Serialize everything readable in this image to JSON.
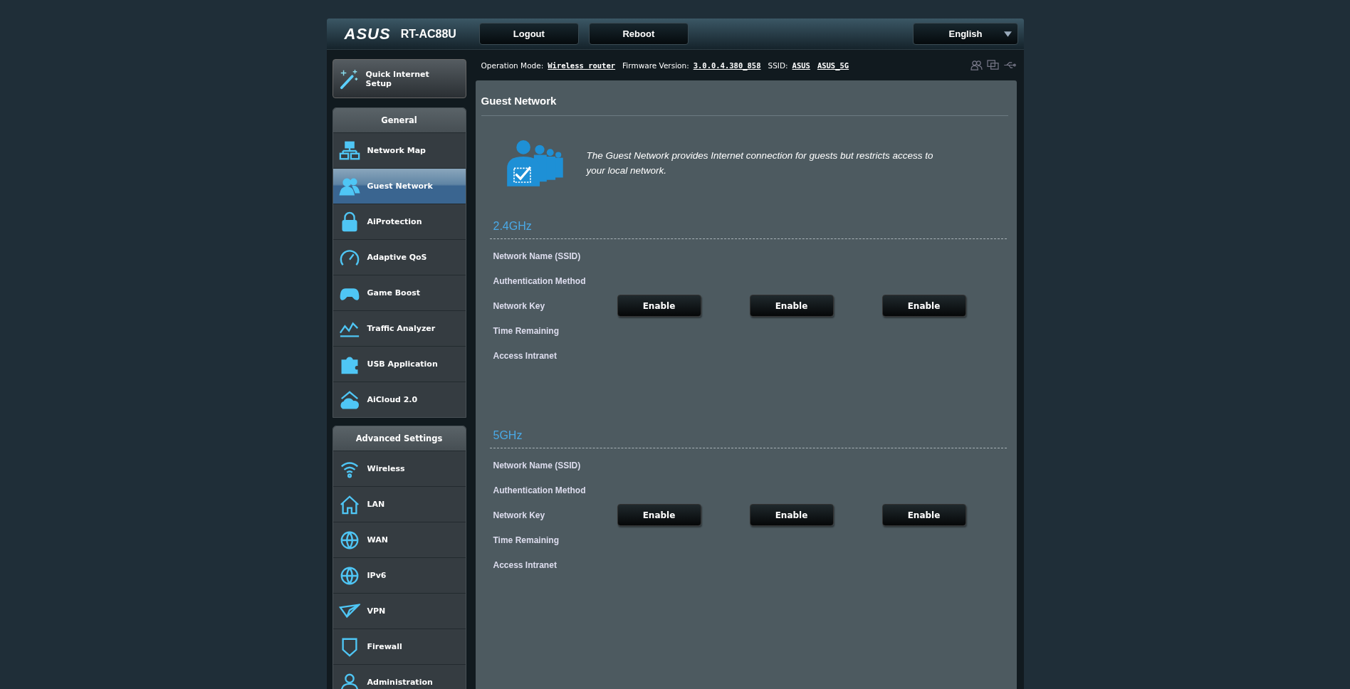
{
  "header": {
    "brand": "ASUS",
    "model": "RT-AC88U",
    "buttons": [
      "Logout",
      "Reboot"
    ],
    "language": "English"
  },
  "status_bar": {
    "items": [
      {
        "label": "Operation Mode:",
        "value": "Wireless router"
      },
      {
        "label": "Firmware Version:",
        "value": "3.0.0.4.380_858"
      },
      {
        "label": "SSID:",
        "value": "ASUS"
      },
      {
        "value": "ASUS_5G"
      }
    ]
  },
  "quick_setup": "Quick Internet Setup",
  "sidebar": [
    {
      "heading": "General",
      "items": [
        {
          "label": "Network Map",
          "selected": false
        },
        {
          "label": "Guest Network",
          "selected": true
        },
        {
          "label": "AiProtection",
          "selected": false
        },
        {
          "label": "Adaptive QoS",
          "selected": false
        },
        {
          "label": "Game Boost",
          "selected": false
        },
        {
          "label": "Traffic Analyzer",
          "selected": false
        },
        {
          "label": "USB Application",
          "selected": false
        },
        {
          "label": "AiCloud 2.0",
          "selected": false
        }
      ]
    },
    {
      "heading": "Advanced Settings",
      "items": [
        {
          "label": "Wireless",
          "selected": false
        },
        {
          "label": "LAN",
          "selected": false
        },
        {
          "label": "WAN",
          "selected": false
        },
        {
          "label": "IPv6",
          "selected": false
        },
        {
          "label": "VPN",
          "selected": false
        },
        {
          "label": "Firewall",
          "selected": false
        },
        {
          "label": "Administration",
          "selected": false
        }
      ]
    }
  ],
  "page": {
    "title": "Guest Network",
    "description": "The Guest Network provides Internet connection for guests but restricts access to your local network.",
    "bands": [
      {
        "name": "2.4GHz",
        "fields": [
          "Network Name (SSID)",
          "Authentication Method",
          "Network Key",
          "Time Remaining",
          "Access Intranet"
        ],
        "buttons": [
          "Enable",
          "Enable",
          "Enable"
        ]
      },
      {
        "name": "5GHz",
        "fields": [
          "Network Name (SSID)",
          "Authentication Method",
          "Network Key",
          "Time Remaining",
          "Access Intranet"
        ],
        "buttons": [
          "Enable",
          "Enable",
          "Enable"
        ]
      }
    ]
  }
}
